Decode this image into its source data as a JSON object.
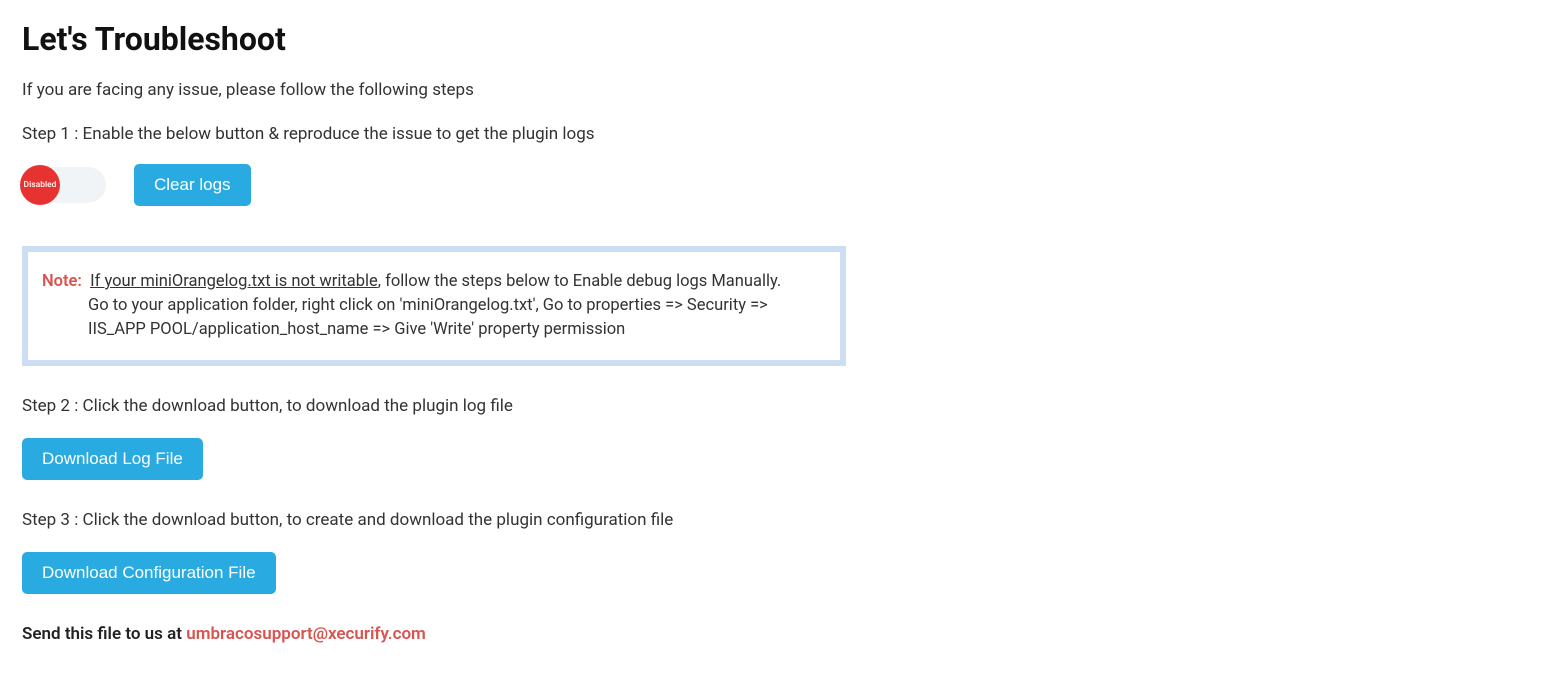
{
  "heading": "Let's Troubleshoot",
  "subtitle": "If you are facing any issue, please follow the following steps",
  "step1": "Step 1 : Enable the below button & reproduce the issue to get the plugin logs",
  "toggle": {
    "state_label": "Disabled"
  },
  "clear_logs_label": "Clear logs",
  "note": {
    "label": "Note:",
    "underline": "If your miniOrangelog.txt is not writable",
    "rest": ", follow the steps below to Enable debug logs Manually.",
    "line2": "Go to your application folder, right click on 'miniOrangelog.txt', Go to properties => Security => IIS_APP POOL/application_host_name => Give 'Write' property permission"
  },
  "step2": "Step 2 : Click the download button, to download the plugin log file",
  "download_log_label": "Download Log File",
  "step3": "Step 3 : Click the download button, to create and download the plugin configuration file",
  "download_config_label": "Download Configuration File",
  "send_prefix": "Send this file to us at ",
  "send_email": "umbracosupport@xecurify.com"
}
